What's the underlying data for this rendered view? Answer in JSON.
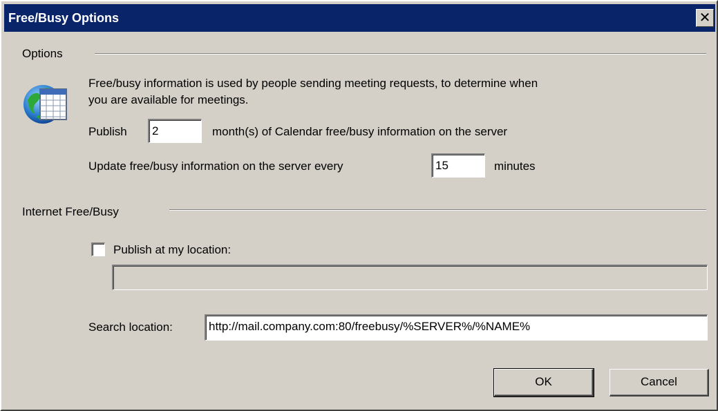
{
  "window": {
    "title": "Free/Busy Options",
    "close_symbol": "✕",
    "title_bar_color": "#0a246a",
    "background_color": "#d4d0c8"
  },
  "options": {
    "group_label": "Options",
    "icon": "calendar-globe-icon",
    "description_line1": "Free/busy information is used by people sending meeting requests, to determine when",
    "description_line2": "you are available for meetings.",
    "publish_label": "Publish",
    "publish_value": "2",
    "publish_suffix": "month(s) of Calendar free/busy information on the server",
    "update_label": "Update free/busy information on the server every",
    "update_value": "15",
    "update_suffix": "minutes"
  },
  "internet": {
    "group_label": "Internet Free/Busy",
    "publish_checkbox_label": "Publish at my location:",
    "publish_checked": false,
    "publish_location_value": "",
    "search_label": "Search location:",
    "search_value": "http://mail.company.com:80/freebusy/%SERVER%/%NAME%"
  },
  "buttons": {
    "ok": "OK",
    "cancel": "Cancel"
  }
}
